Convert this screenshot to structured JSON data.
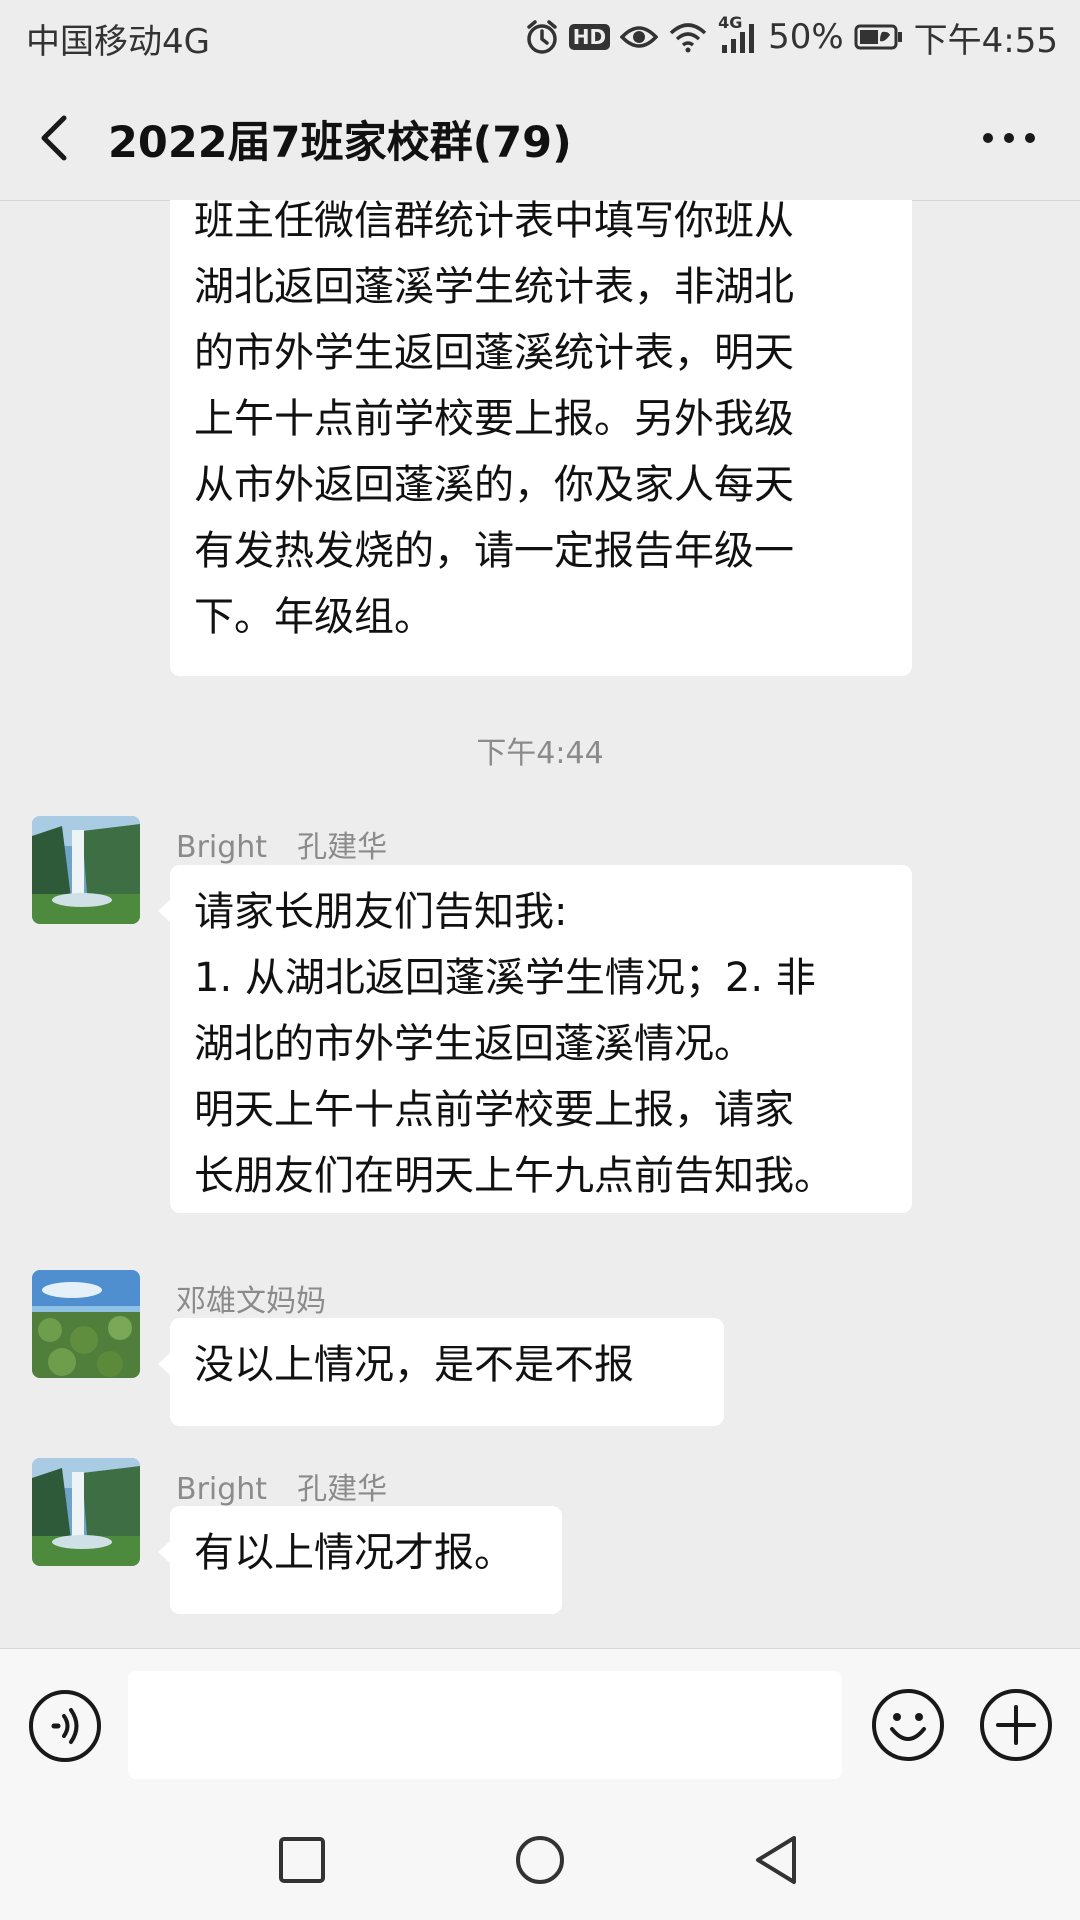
{
  "status_bar": {
    "carrier": "中国移动4G",
    "hd": "HD",
    "network": "4G",
    "battery": "50%",
    "time": "下午4:55"
  },
  "title_bar": {
    "title": "2022届7班家校群(79)"
  },
  "messages": {
    "first": {
      "lines": [
        "班主任微信群统计表中填写你班从",
        "湖北返回蓬溪学生统计表，非湖北",
        "的市外学生返回蓬溪统计表，明天",
        "上午十点前学校要上报。另外我级",
        "从市外返回蓬溪的，你及家人每天",
        "有发热发烧的，请一定报告年级一",
        "下。年级组。"
      ]
    },
    "timestamp": "下午4:44",
    "second": {
      "sender": "Bright　孔建华",
      "lines": [
        "请家长朋友们告知我:",
        "1. 从湖北返回蓬溪学生情况；2. 非",
        "湖北的市外学生返回蓬溪情况。",
        "明天上午十点前学校要上报，请家",
        "长朋友们在明天上午九点前告知我。"
      ]
    },
    "third": {
      "sender": "邓雄文妈妈",
      "text": "没以上情况，是不是不报"
    },
    "fourth": {
      "sender": "Bright　孔建华",
      "text": "有以上情况才报。"
    }
  },
  "input_bar": {
    "placeholder": "",
    "icons": [
      "voice-icon",
      "emoji-icon",
      "plus-icon"
    ]
  },
  "nav_bar": {
    "icons": [
      "recents-icon",
      "home-icon",
      "back-icon"
    ]
  },
  "colors": {
    "background": "#ededed",
    "bubble": "#ffffff",
    "meta_text": "#8b8b8b"
  }
}
